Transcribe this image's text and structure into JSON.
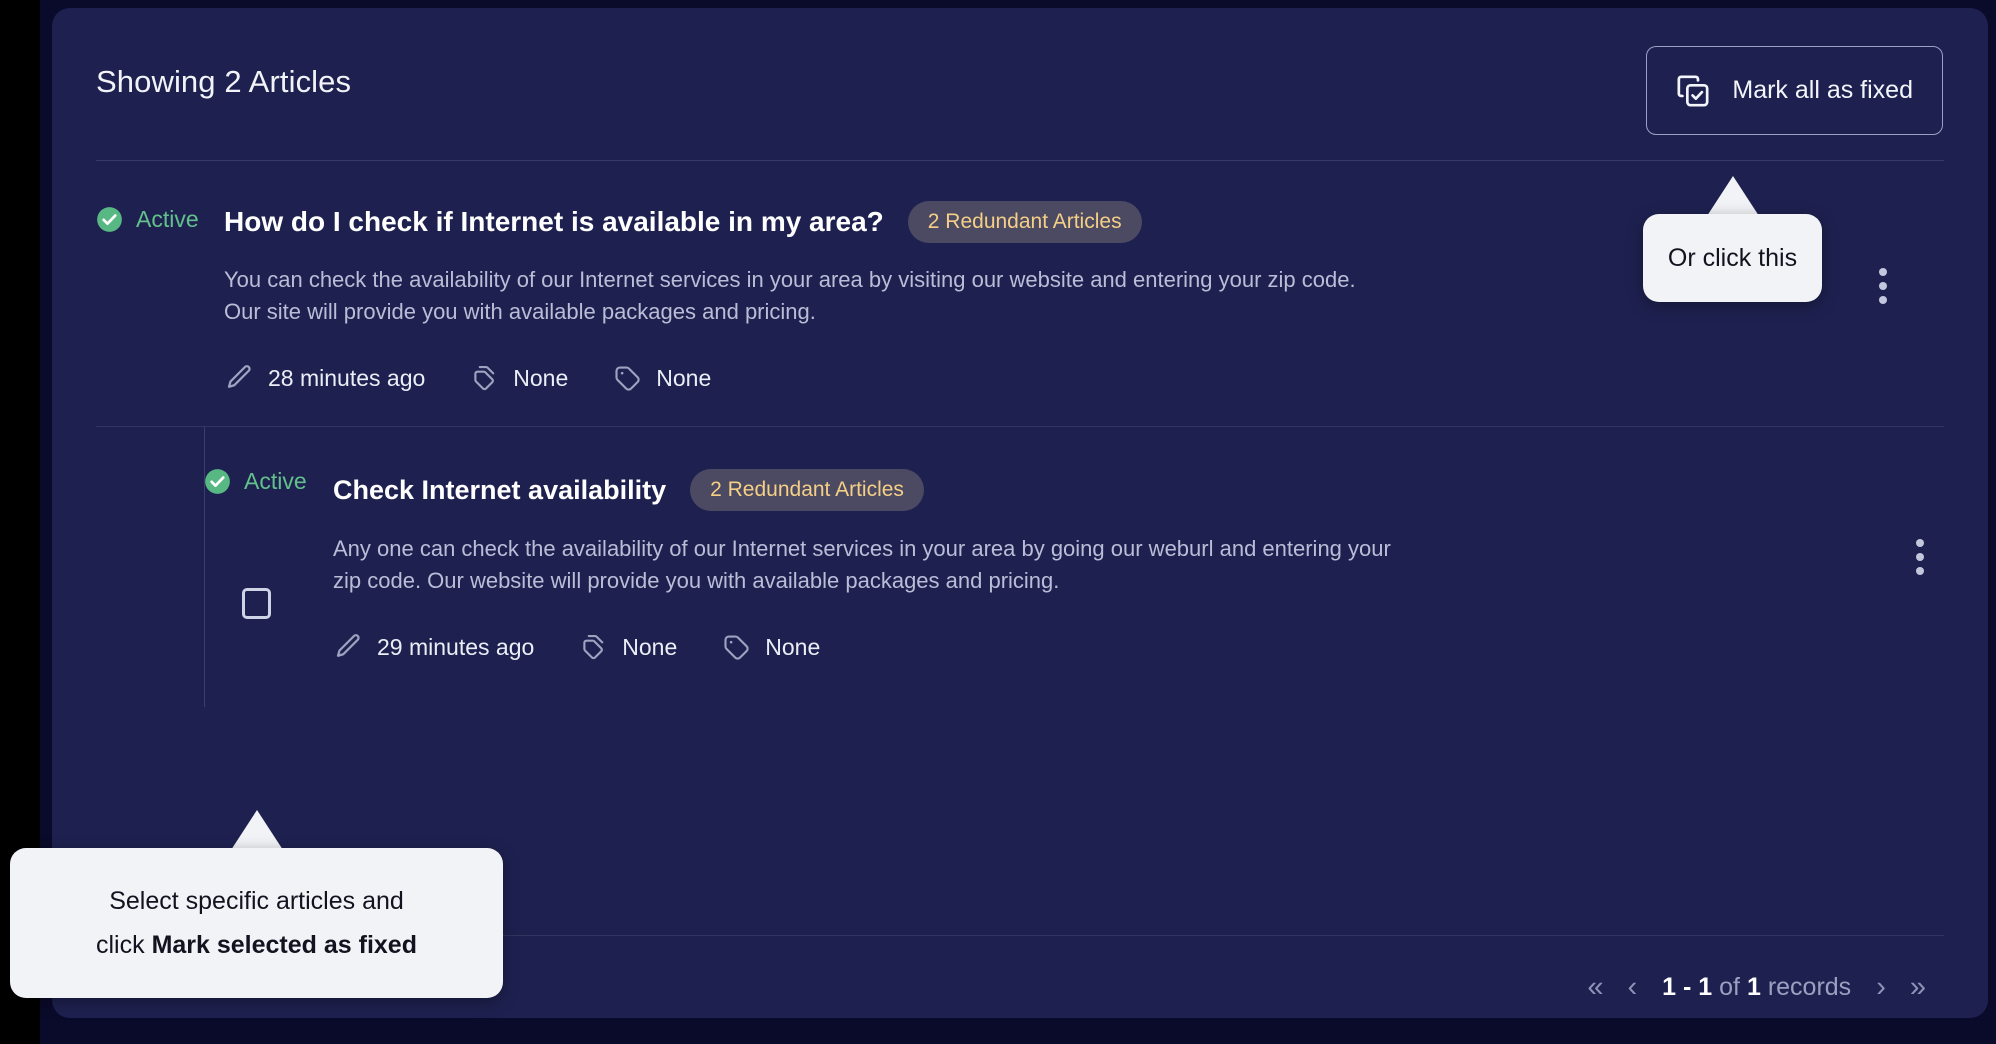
{
  "header": {
    "title": "Showing 2 Articles",
    "mark_all_button": {
      "label": "Mark all as fixed",
      "icon": "copy-check-icon"
    }
  },
  "articles": [
    {
      "status": "Active",
      "status_icon": "check-circle-icon",
      "title": "How do I check if Internet is available in my area?",
      "badge": "2 Redundant Articles",
      "body_line1": "You can check the availability of our Internet services in your area by visiting our website and entering your zip code.",
      "body_line2": "Our site will provide you with available packages and pricing.",
      "meta": [
        {
          "icon": "pencil-icon",
          "text": "28 minutes ago"
        },
        {
          "icon": "tags-icon",
          "text": "None"
        },
        {
          "icon": "tag-icon",
          "text": "None"
        }
      ]
    },
    {
      "status": "Active",
      "status_icon": "check-circle-icon",
      "title": "Check Internet availability",
      "badge": "2 Redundant Articles",
      "body_line1": "Any one can check the availability of our Internet services in your area by going our weburl and entering your",
      "body_line2": "zip code. Our website will provide you with available packages and pricing.",
      "meta": [
        {
          "icon": "pencil-icon",
          "text": "29 minutes ago"
        },
        {
          "icon": "tags-icon",
          "text": "None"
        },
        {
          "icon": "tag-icon",
          "text": "None"
        }
      ]
    }
  ],
  "row_menu_icon": "kebab-menu-icon",
  "select_checkbox": {
    "checked": false,
    "name": "article-select-checkbox"
  },
  "pagination": {
    "first_icon": "«",
    "prev_icon": "‹",
    "range": "1 - 1",
    "of_word": "of",
    "total": "1",
    "records_word": "records",
    "next_icon": "›",
    "last_icon": "»"
  },
  "tooltips": {
    "or_click": "Or click this",
    "select_line1": "Select specific articles and",
    "select_line2_prefix": "click ",
    "select_line2_bold": "Mark selected as fixed"
  },
  "colors": {
    "page_background": "#0a0a2b",
    "card_background": "#1e2150",
    "accent_green": "#62c08b",
    "badge_background": "#4c4a62",
    "badge_text": "#f5cf86",
    "tooltip_background": "#f2f3f7",
    "divider": "#31355f"
  }
}
